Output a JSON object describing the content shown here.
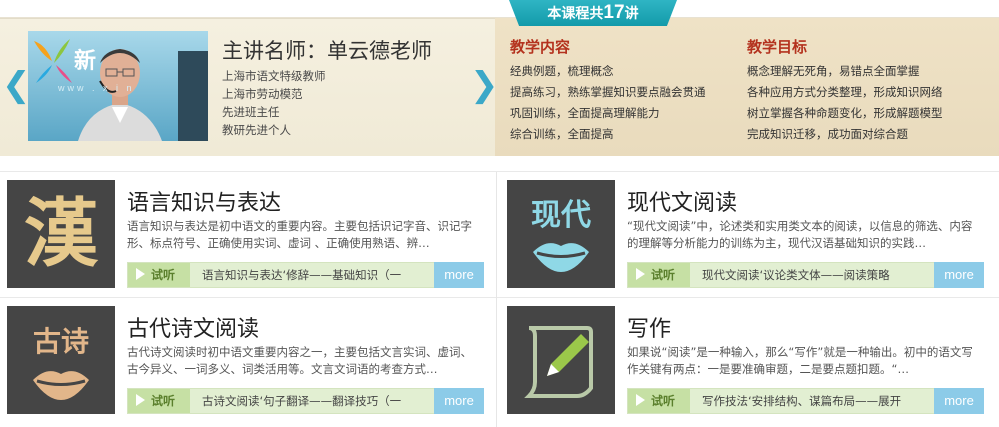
{
  "header": {
    "course_count_prefix": "本课程共",
    "course_count": "17",
    "course_count_suffix": "讲"
  },
  "teacher": {
    "title": "主讲名师：单云德老师",
    "logo_text": "新",
    "logo_url": "www . x i n",
    "credentials": [
      "上海市语文特级教师",
      "上海市劳动模范",
      "先进班主任",
      "教研先进个人"
    ]
  },
  "content": {
    "heading": "教学内容",
    "items": [
      "经典例题，梳理概念",
      "提高练习，熟练掌握知识要点融会贯通",
      "巩固训练，全面提高理解能力",
      "综合训练，全面提高"
    ]
  },
  "goals": {
    "heading": "教学目标",
    "items": [
      "概念理解无死角，易错点全面掌握",
      "各种应用方式分类整理，形成知识网络",
      "树立掌握各种命题变化，形成解题模型",
      "完成知识迁移，成功面对综合题"
    ]
  },
  "cards": [
    {
      "title": "语言知识与表达",
      "icon_char": "漢",
      "desc": "语言知识与表达是初中语文的重要内容。主要包括识记字音、识记字形、标点符号、正确使用实词、虚词 、正确使用熟语、辨…",
      "listen": "试听",
      "lesson": "语言知识与表达‘修辞——基础知识（一",
      "more": "more"
    },
    {
      "title": "现代文阅读",
      "icon_char": "现代",
      "desc": "“现代文阅读”中，论述类和实用类文本的阅读，以信息的筛选、内容的理解等分析能力的训练为主，现代汉语基础知识的实践…",
      "listen": "试听",
      "lesson": "现代文阅读‘议论类文体——阅读策略",
      "more": "more"
    },
    {
      "title": "古代诗文阅读",
      "icon_char": "古诗",
      "desc": "古代诗文阅读时初中语文重要内容之一，主要包括文言实词、虚词、古今异义、一词多义、词类活用等。文言文词语的考查方式…",
      "listen": "试听",
      "lesson": "古诗文阅读‘句子翻译——翻译技巧（一",
      "more": "more"
    },
    {
      "title": "写作",
      "icon_char": "",
      "desc": "如果说“阅读”是一种输入，那么“写作”就是一种输出。初中的语文写作关键有两点：一是要准确审题，二是要点题扣题。“…",
      "listen": "试听",
      "lesson": "写作技法‘安排结构、谋篇布局——展开",
      "more": "more"
    }
  ],
  "colors": {
    "accent_teal": "#139aaa",
    "heading_red": "#b4321e",
    "listen_green": "#c6e0a4",
    "more_blue": "#8ccbe8",
    "icon_bg": "#454545"
  }
}
